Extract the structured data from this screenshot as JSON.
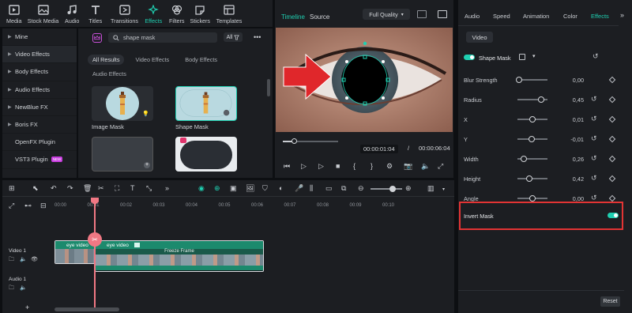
{
  "toolbar": {
    "items": [
      {
        "label": "Media",
        "icon": "media-icon"
      },
      {
        "label": "Stock Media",
        "icon": "stock-media-icon"
      },
      {
        "label": "Audio",
        "icon": "music-note-icon"
      },
      {
        "label": "Titles",
        "icon": "titles-icon"
      },
      {
        "label": "Transitions",
        "icon": "transitions-icon"
      },
      {
        "label": "Effects",
        "icon": "effects-icon",
        "active": true
      },
      {
        "label": "Filters",
        "icon": "filters-icon"
      },
      {
        "label": "Stickers",
        "icon": "stickers-icon"
      },
      {
        "label": "Templates",
        "icon": "templates-icon"
      }
    ]
  },
  "sidebar": {
    "items": [
      {
        "label": "Mine"
      },
      {
        "label": "Video Effects",
        "active": true
      },
      {
        "label": "Body Effects"
      },
      {
        "label": "Audio Effects"
      },
      {
        "label": "NewBlue FX"
      },
      {
        "label": "Boris FX"
      },
      {
        "label": "OpenFX Plugin"
      },
      {
        "label": "VST3 Plugin",
        "badge": "NEW"
      }
    ]
  },
  "library": {
    "search_value": "shape mask",
    "filter_label": "All",
    "categories": [
      "All Results",
      "Video Effects",
      "Body Effects",
      "Audio Effects"
    ],
    "results": [
      {
        "label": "Image Mask"
      },
      {
        "label": "Shape Mask",
        "selected": true
      },
      {
        "label": ""
      },
      {
        "label": ""
      }
    ]
  },
  "preview": {
    "tab_timeline": "Timeline",
    "tab_source": "Source",
    "quality": "Full Quality",
    "current_time": "00:00:01:04",
    "separator": "/",
    "total_time": "00:00:06:04",
    "progress": 0.2
  },
  "properties": {
    "tabs": [
      "Audio",
      "Speed",
      "Animation",
      "Color",
      "Effects"
    ],
    "subtab": "Video",
    "effect_name": "Shape Mask",
    "rows": [
      {
        "label": "Blur Strength",
        "value": "0,00",
        "pos": 0.05
      },
      {
        "label": "Radius",
        "value": "0,45",
        "pos": 0.78
      },
      {
        "label": "X",
        "value": "0,01",
        "pos": 0.5
      },
      {
        "label": "Y",
        "value": "-0,01",
        "pos": 0.48
      },
      {
        "label": "Width",
        "value": "0,26",
        "pos": 0.2
      },
      {
        "label": "Height",
        "value": "0,42",
        "pos": 0.4
      },
      {
        "label": "Angle",
        "value": "0,00",
        "pos": 0.5
      }
    ],
    "invert_label": "Invert Mask",
    "invert_on": true,
    "reset_label": "Reset"
  },
  "timeline": {
    "ticks": [
      "00:00",
      "00:01",
      "00:02",
      "00:03",
      "00:04",
      "00:05",
      "00:06",
      "00:07",
      "00:08",
      "00:09",
      "00:10"
    ],
    "video_track_label": "Video 1",
    "audio_track_label": "Audio 1",
    "clip1_label": "eye video",
    "clip2_label": "eye video",
    "freeze_label": "Freeze Frame"
  },
  "colors": {
    "accent": "#1fcfb1",
    "highlight": "#e23434",
    "playhead": "#f07884"
  }
}
